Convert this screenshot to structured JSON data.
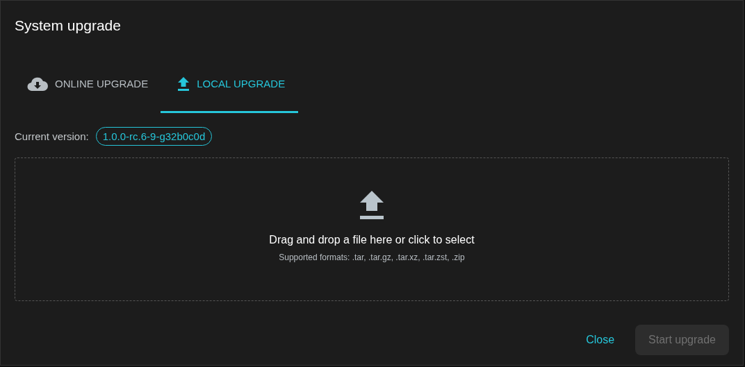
{
  "dialog": {
    "title": "System upgrade"
  },
  "tabs": [
    {
      "label": "ONLINE UPGRADE",
      "kind": "cloud",
      "selected": false
    },
    {
      "label": "LOCAL UPGRADE",
      "kind": "upload",
      "selected": true
    }
  ],
  "current_version": {
    "label": "Current version:",
    "value": "1.0.0-rc.6-9-g32b0c0d"
  },
  "dropzone": {
    "text": "Drag and drop a file here or click to select",
    "formats": "Supported formats: .tar, .tar.gz, .tar.xz, .tar.zst, .zip"
  },
  "buttons": [
    {
      "label": "Close",
      "kind": "text",
      "disabled": false
    },
    {
      "label": "Start upgrade",
      "kind": "filled",
      "disabled": true
    }
  ]
}
